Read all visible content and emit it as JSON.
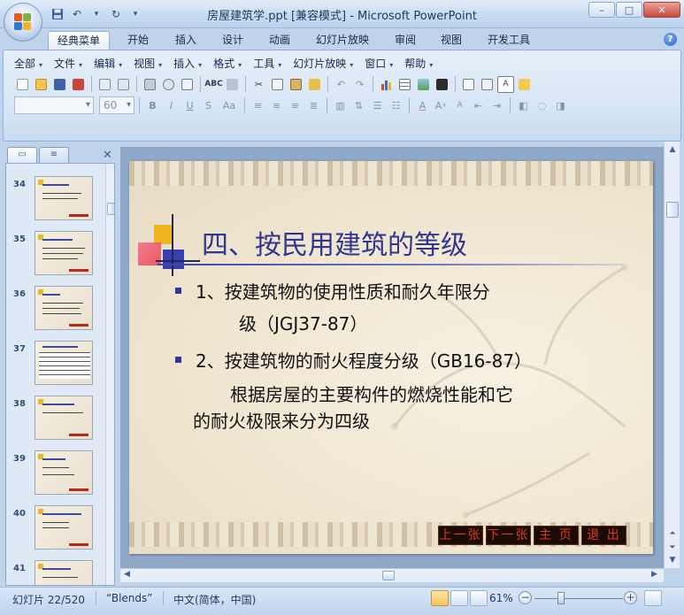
{
  "window": {
    "title": "房屋建筑学.ppt [兼容模式] - Microsoft PowerPoint",
    "controls": [
      "–",
      "□",
      "✕"
    ]
  },
  "ribbon_tabs": [
    {
      "label": "经典菜单",
      "active": true
    },
    {
      "label": "开始"
    },
    {
      "label": "插入"
    },
    {
      "label": "设计"
    },
    {
      "label": "动画"
    },
    {
      "label": "幻灯片放映"
    },
    {
      "label": "审阅"
    },
    {
      "label": "视图"
    },
    {
      "label": "开发工具"
    }
  ],
  "classic_menu": [
    "全部",
    "文件",
    "编辑",
    "视图",
    "插入",
    "格式",
    "工具",
    "幻灯片放映",
    "窗口",
    "帮助"
  ],
  "format_bar": {
    "font_name": "",
    "font_size": "60",
    "style_buttons": [
      "B",
      "I",
      "U",
      "S",
      "Aa"
    ]
  },
  "slide_pane": {
    "tabs": [
      "slides-tab",
      "outline-tab"
    ],
    "thumbnails": [
      {
        "number": "34"
      },
      {
        "number": "35"
      },
      {
        "number": "36"
      },
      {
        "number": "37"
      },
      {
        "number": "38"
      },
      {
        "number": "39"
      },
      {
        "number": "40"
      },
      {
        "number": "41"
      }
    ]
  },
  "slide": {
    "title": "四、按民用建筑的等级",
    "bullets": [
      {
        "line1": "1、按建筑物的使用性质和耐久年限分",
        "line2": "级（JGJ37-87）"
      },
      {
        "line1": "2、按建筑物的耐火程度分级（GB16-87）"
      }
    ],
    "paragraph": [
      "根据房屋的主要构件的燃烧性能和它",
      "的耐火极限来分为四级"
    ],
    "nav_buttons": [
      "上一张",
      "下一张",
      "主 页",
      "退 出"
    ]
  },
  "status_bar": {
    "slide_info": "幻灯片 22/520",
    "theme": "“Blends”",
    "language": "中文(简体，中国)",
    "zoom": "61%",
    "zoom_fraction": 0.61
  },
  "colors": {
    "ribbon_bg": "#bfd3ea",
    "title_color": "#30358f",
    "nav_button_text": "#e23b1c",
    "bullet_square": "#3232a0"
  }
}
